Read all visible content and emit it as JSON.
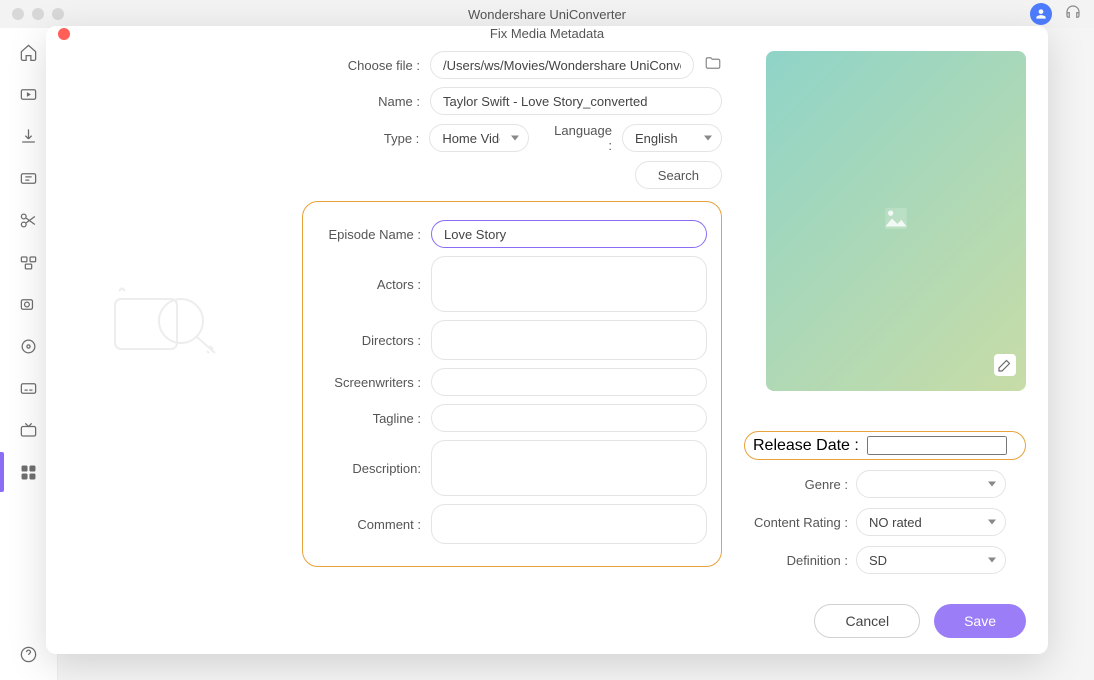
{
  "app_title": "Wondershare UniConverter",
  "modal_title": "Fix Media Metadata",
  "form": {
    "choose_file_label": "Choose file :",
    "choose_file_value": "/Users/ws/Movies/Wondershare UniConverter/Con",
    "name_label": "Name :",
    "name_value": "Taylor Swift - Love Story_converted",
    "type_label": "Type :",
    "type_value": "Home Video",
    "language_label": "Language :",
    "language_value": "English",
    "search_label": "Search",
    "episode_name_label": "Episode Name :",
    "episode_name_value": "Love Story",
    "actors_label": "Actors :",
    "actors_value": "",
    "directors_label": "Directors :",
    "directors_value": "",
    "screenwriters_label": "Screenwriters :",
    "screenwriters_value": "",
    "tagline_label": "Tagline :",
    "tagline_value": "",
    "description_label": "Description:",
    "description_value": "",
    "comment_label": "Comment :",
    "comment_value": ""
  },
  "meta": {
    "release_date_label": "Release Date :",
    "release_date_value": "",
    "genre_label": "Genre :",
    "genre_value": "",
    "content_rating_label": "Content Rating :",
    "content_rating_value": "NO rated",
    "definition_label": "Definition :",
    "definition_value": "SD"
  },
  "buttons": {
    "cancel": "Cancel",
    "save": "Save"
  }
}
